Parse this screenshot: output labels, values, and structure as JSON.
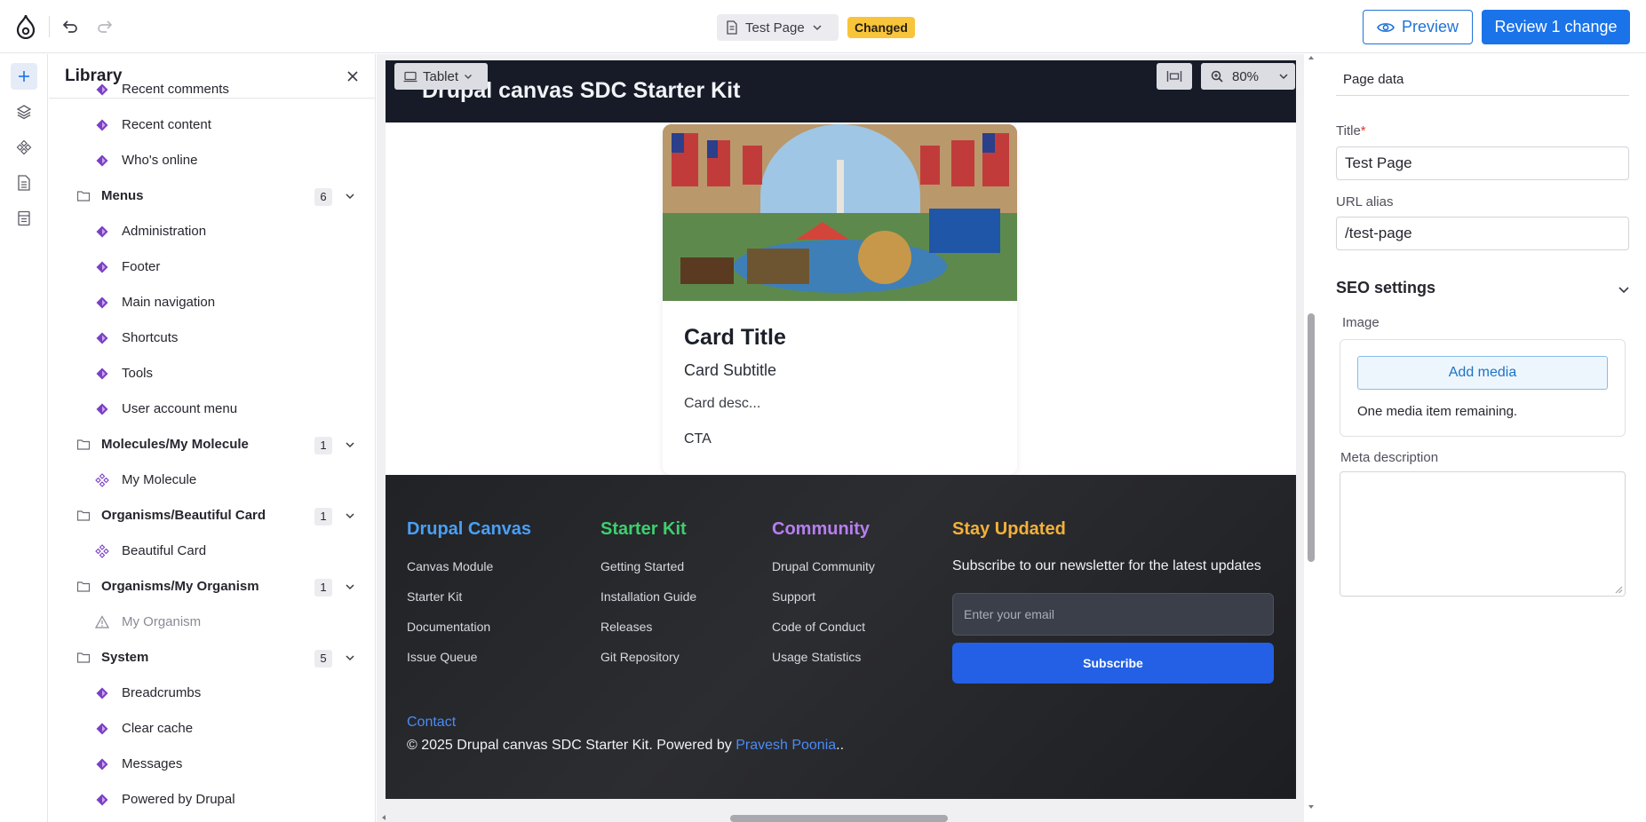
{
  "topbar": {
    "page_name": "Test Page",
    "changed_badge": "Changed",
    "preview_label": "Preview",
    "review_label": "Review 1 change"
  },
  "library": {
    "title": "Library",
    "items": [
      {
        "type": "component",
        "label": "Recent comments"
      },
      {
        "type": "component",
        "label": "Recent content"
      },
      {
        "type": "component",
        "label": "Who's online"
      },
      {
        "type": "folder",
        "label": "Menus",
        "count": "6"
      },
      {
        "type": "component",
        "label": "Administration"
      },
      {
        "type": "component",
        "label": "Footer"
      },
      {
        "type": "component",
        "label": "Main navigation"
      },
      {
        "type": "component",
        "label": "Shortcuts"
      },
      {
        "type": "component",
        "label": "Tools"
      },
      {
        "type": "component",
        "label": "User account menu"
      },
      {
        "type": "folder",
        "label": "Molecules/My Molecule",
        "count": "1"
      },
      {
        "type": "sdc",
        "label": "My Molecule"
      },
      {
        "type": "folder",
        "label": "Organisms/Beautiful Card",
        "count": "1"
      },
      {
        "type": "sdc",
        "label": "Beautiful Card"
      },
      {
        "type": "folder",
        "label": "Organisms/My Organism",
        "count": "1"
      },
      {
        "type": "warning",
        "label": "My Organism"
      },
      {
        "type": "folder",
        "label": "System",
        "count": "5"
      },
      {
        "type": "component",
        "label": "Breadcrumbs"
      },
      {
        "type": "component",
        "label": "Clear cache"
      },
      {
        "type": "component",
        "label": "Messages"
      },
      {
        "type": "component",
        "label": "Powered by Drupal"
      }
    ]
  },
  "canvas": {
    "device": "Tablet",
    "zoom": "80%",
    "site_title": "Drupal canvas SDC Starter Kit",
    "card": {
      "title": "Card Title",
      "subtitle": "Card Subtitle",
      "description": "Card desc...",
      "cta": "CTA"
    },
    "footer": {
      "columns": [
        {
          "heading": "Drupal Canvas",
          "color": "#4a9ff5",
          "links": [
            "Canvas Module",
            "Starter Kit",
            "Documentation",
            "Issue Queue"
          ]
        },
        {
          "heading": "Starter Kit",
          "color": "#3ecf6e",
          "links": [
            "Getting Started",
            "Installation Guide",
            "Releases",
            "Git Repository"
          ]
        },
        {
          "heading": "Community",
          "color": "#b77ef0",
          "links": [
            "Drupal Community",
            "Support",
            "Code of Conduct",
            "Usage Statistics"
          ]
        }
      ],
      "newsletter": {
        "heading": "Stay Updated",
        "color": "#f2b13a",
        "text": "Subscribe to our newsletter for the latest updates",
        "placeholder": "Enter your email",
        "button": "Subscribe"
      },
      "contact": "Contact",
      "copyright_prefix": "© 2025 Drupal canvas SDC Starter Kit. Powered by ",
      "author": "Pravesh Poonia",
      "copyright_suffix": ".."
    }
  },
  "panel": {
    "tab": "Page data",
    "title_label": "Title",
    "title_value": "Test Page",
    "alias_label": "URL alias",
    "alias_value": "/test-page",
    "seo_title": "SEO settings",
    "image_label": "Image",
    "add_media": "Add media",
    "media_note": "One media item remaining.",
    "meta_label": "Meta description"
  },
  "colors": {
    "accent": "#1a73e8",
    "badge": "#f8c43a",
    "component_icon": "#7b3fc4"
  }
}
